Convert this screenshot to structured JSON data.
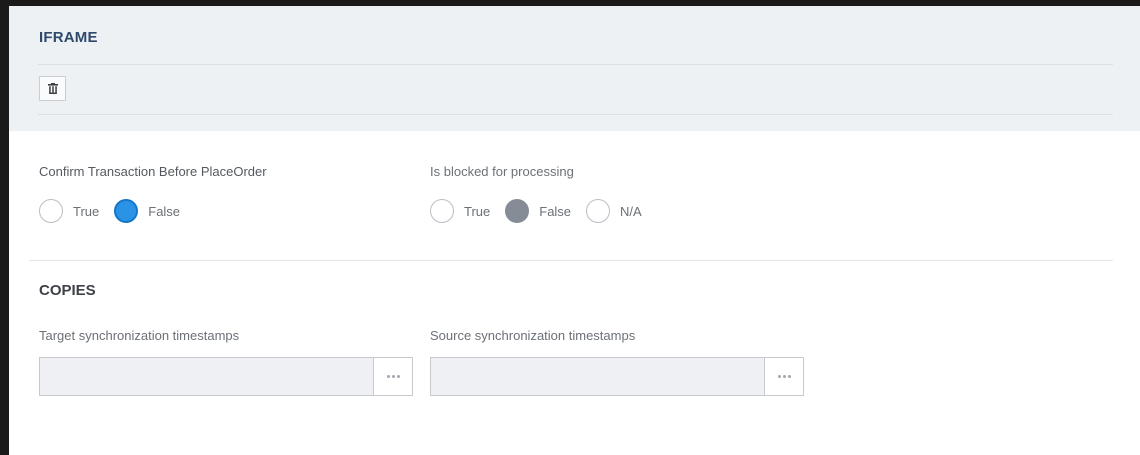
{
  "iframe": {
    "title": "IFRAME",
    "delete_icon": "trash-icon"
  },
  "confirm_transaction": {
    "label": "Confirm Transaction Before PlaceOrder",
    "options": [
      "True",
      "False"
    ],
    "selected": "False"
  },
  "blocked_for_processing": {
    "label": "Is blocked for processing",
    "options": [
      "True",
      "False",
      "N/A"
    ],
    "selected": "False"
  },
  "copies": {
    "title": "COPIES",
    "target": {
      "label": "Target synchronization timestamps",
      "value": "",
      "button_icon": "ellipsis-icon"
    },
    "source": {
      "label": "Source synchronization timestamps",
      "value": "",
      "button_icon": "ellipsis-icon"
    }
  },
  "colors": {
    "header_bg": "#eef1f4",
    "title": "#2d4a6b",
    "radio_selected_active": "#2a93e6",
    "radio_selected_disabled": "#858c95"
  }
}
